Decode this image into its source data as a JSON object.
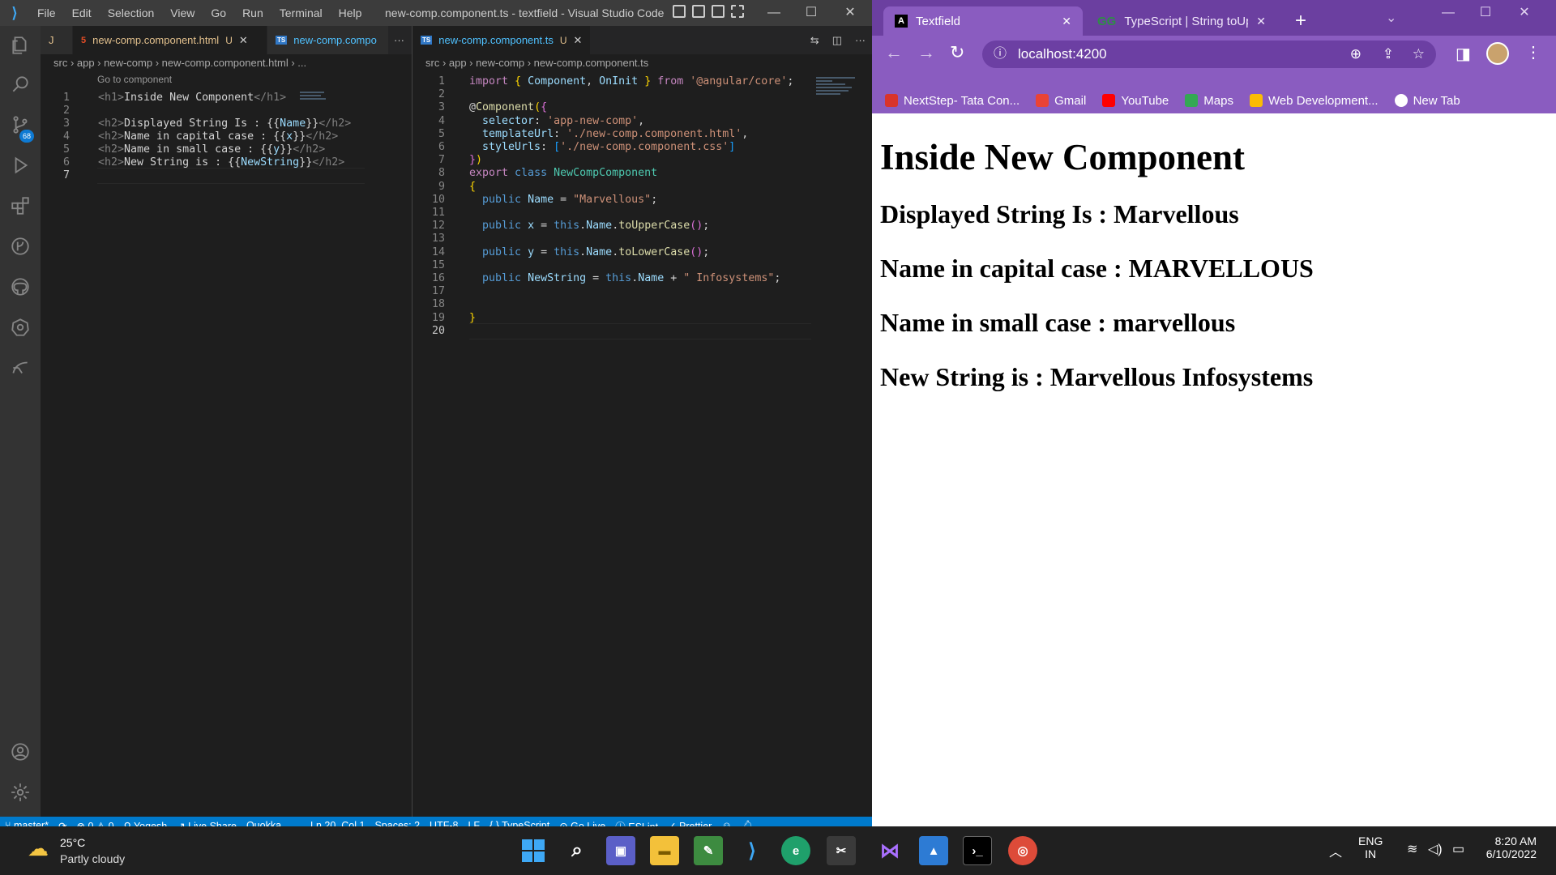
{
  "vscode": {
    "window_title": "new-comp.component.ts - textfield - Visual Studio Code",
    "menu": [
      "File",
      "Edit",
      "Selection",
      "View",
      "Go",
      "Run",
      "Terminal",
      "Help"
    ],
    "scm_badge": "68",
    "left_group": {
      "tabs": [
        {
          "label": "J",
          "modified": ""
        },
        {
          "label": "new-comp.component.html",
          "modified": "U"
        },
        {
          "label": "new-comp.compo",
          "modified": ""
        }
      ],
      "more": "···",
      "breadcrumb": "src  ›  app  ›  new-comp  ›  new-comp.component.html  ›  ...",
      "codelens": "Go to component",
      "line_numbers": [
        "1",
        "2",
        "3",
        "4",
        "5",
        "6",
        "7"
      ],
      "lines": [
        "<h1>Inside New Component</h1>",
        "",
        "<h2>Displayed String Is : {{Name}}</h2>",
        "<h2>Name in capital case : {{x}}</h2>",
        "<h2>Name in small case : {{y}}</h2>",
        "<h2>New String is : {{NewString}}</h2>",
        ""
      ]
    },
    "right_group": {
      "tabs": [
        {
          "label": "new-comp.component.ts",
          "modified": "U"
        }
      ],
      "breadcrumb": "src  ›  app  ›  new-comp  ›  new-comp.component.ts",
      "line_numbers": [
        "1",
        "2",
        "3",
        "4",
        "5",
        "6",
        "7",
        "8",
        "9",
        "10",
        "11",
        "12",
        "13",
        "14",
        "15",
        "16",
        "17",
        "18",
        "19",
        "20"
      ]
    },
    "status_bar": {
      "branch": "master*",
      "errors": "0",
      "warnings": "0",
      "user": "Yogesh",
      "live_share": "Live Share",
      "quokka": "Quokka",
      "cursor": "Ln 20, Col 1",
      "spaces": "Spaces: 2",
      "encoding": "UTF-8",
      "eol": "LF",
      "language": "TypeScript",
      "go_live": "Go Live",
      "eslint": "ESLint",
      "prettier": "Prettier"
    }
  },
  "chrome": {
    "tabs": [
      {
        "title": "Textfield"
      },
      {
        "title": "TypeScript | String toUpp"
      }
    ],
    "new_tab": "+",
    "url": "localhost:4200",
    "bookmarks": [
      {
        "label": "NextStep- Tata Con...",
        "color": "#d9342b"
      },
      {
        "label": "Gmail",
        "color": "#ea4335"
      },
      {
        "label": "YouTube",
        "color": "#ff0000"
      },
      {
        "label": "Maps",
        "color": "#34a853"
      },
      {
        "label": "Web Development...",
        "color": "#fbbc04"
      },
      {
        "label": "New Tab",
        "color": "#ffffff"
      }
    ],
    "page": {
      "h1": "Inside New Component",
      "h2": [
        "Displayed String Is : Marvellous",
        "Name in capital case : MARVELLOUS",
        "Name in small case : marvellous",
        "New String is : Marvellous Infosystems"
      ]
    }
  },
  "taskbar": {
    "weather_temp": "25°C",
    "weather_desc": "Partly cloudy",
    "lang_top": "ENG",
    "lang_bottom": "IN",
    "time": "8:20 AM",
    "date": "6/10/2022"
  }
}
